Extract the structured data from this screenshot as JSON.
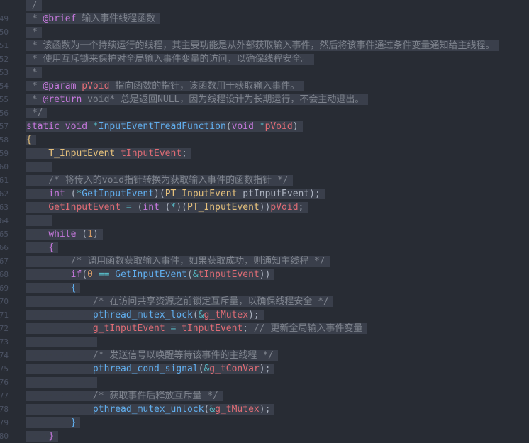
{
  "line_numbers": [
    "",
    "49",
    "50",
    "51",
    "52",
    "53",
    "54",
    "55",
    "56",
    "57",
    "58",
    "59",
    "60",
    "61",
    "62",
    "63",
    "64",
    "65",
    "66",
    "67",
    "68",
    "69",
    "70",
    "71",
    "72",
    "73",
    "74",
    "75",
    "76",
    "77",
    "78",
    "79",
    "80",
    ""
  ],
  "lines": [
    [
      {
        "c": "cm",
        "t": " /"
      }
    ],
    [
      {
        "c": "cm",
        "t": " * "
      },
      {
        "c": "tag",
        "t": "@brief"
      },
      {
        "c": "cm",
        "t": " 输入事件线程函数"
      }
    ],
    [
      {
        "c": "cm",
        "t": " *"
      }
    ],
    [
      {
        "c": "cm",
        "t": " * 该函数为一个持续运行的线程，其主要功能是从外部获取输入事件，然后将该事件通过条件变量通知给主线程。"
      }
    ],
    [
      {
        "c": "cm",
        "t": " * 使用互斥锁来保护对全局输入事件变量的访问，以确保线程安全。"
      }
    ],
    [
      {
        "c": "cm",
        "t": " *"
      }
    ],
    [
      {
        "c": "cm",
        "t": " * "
      },
      {
        "c": "tag",
        "t": "@param"
      },
      {
        "c": "cm",
        "t": " "
      },
      {
        "c": "var",
        "t": "pVoid"
      },
      {
        "c": "cm",
        "t": " 指向函数的指针，该函数用于获取输入事件。"
      }
    ],
    [
      {
        "c": "cm",
        "t": " * "
      },
      {
        "c": "tag",
        "t": "@return"
      },
      {
        "c": "cm",
        "t": " void* 总是返回NULL，因为线程设计为长期运行，不会主动退出。"
      }
    ],
    [
      {
        "c": "cm",
        "t": " */"
      }
    ],
    [
      {
        "c": "kw",
        "t": "static"
      },
      {
        "c": "pl",
        "t": " "
      },
      {
        "c": "kw",
        "t": "void"
      },
      {
        "c": "pl",
        "t": " "
      },
      {
        "c": "op",
        "t": "*"
      },
      {
        "c": "fn",
        "t": "InputEventTreadFunction"
      },
      {
        "c": "pl",
        "t": "("
      },
      {
        "c": "kw",
        "t": "void"
      },
      {
        "c": "pl",
        "t": " "
      },
      {
        "c": "op",
        "t": "*"
      },
      {
        "c": "var",
        "t": "pVoid"
      },
      {
        "c": "pl",
        "t": ")"
      }
    ],
    [
      {
        "c": "ty",
        "t": "{"
      }
    ],
    [
      {
        "c": "dots",
        "t": "····"
      },
      {
        "c": "ty",
        "t": "T_InputEvent"
      },
      {
        "c": "pl",
        "t": " "
      },
      {
        "c": "var",
        "t": "tInputEvent"
      },
      {
        "c": "pl",
        "t": ";"
      }
    ],
    [
      {
        "c": "dots",
        "t": "····"
      }
    ],
    [
      {
        "c": "dots",
        "t": "····"
      },
      {
        "c": "cm",
        "t": "/* 将传入的void指针转换为获取输入事件的函数指针 */"
      }
    ],
    [
      {
        "c": "dots",
        "t": "····"
      },
      {
        "c": "kw",
        "t": "int"
      },
      {
        "c": "pl",
        "t": " ("
      },
      {
        "c": "op",
        "t": "*"
      },
      {
        "c": "fn",
        "t": "GetInputEvent"
      },
      {
        "c": "pl",
        "t": ")("
      },
      {
        "c": "ty",
        "t": "PT_InputEvent"
      },
      {
        "c": "pl",
        "t": " ptInputEvent);"
      }
    ],
    [
      {
        "c": "dots",
        "t": "····"
      },
      {
        "c": "var",
        "t": "GetInputEvent"
      },
      {
        "c": "pl",
        "t": " "
      },
      {
        "c": "op",
        "t": "="
      },
      {
        "c": "pl",
        "t": " ("
      },
      {
        "c": "kw",
        "t": "int"
      },
      {
        "c": "pl",
        "t": " ("
      },
      {
        "c": "op",
        "t": "*"
      },
      {
        "c": "pl",
        "t": ")("
      },
      {
        "c": "ty",
        "t": "PT_InputEvent"
      },
      {
        "c": "pl",
        "t": "))"
      },
      {
        "c": "var",
        "t": "pVoid"
      },
      {
        "c": "pl",
        "t": ";"
      }
    ],
    [
      {
        "c": "dots",
        "t": "····"
      }
    ],
    [
      {
        "c": "dots",
        "t": "····"
      },
      {
        "c": "kw",
        "t": "while"
      },
      {
        "c": "pl",
        "t": " ("
      },
      {
        "c": "num",
        "t": "1"
      },
      {
        "c": "pl",
        "t": ")"
      }
    ],
    [
      {
        "c": "dots",
        "t": "····"
      },
      {
        "c": "kw",
        "t": "{"
      }
    ],
    [
      {
        "c": "dots",
        "t": "········"
      },
      {
        "c": "cm",
        "t": "/* 调用函数获取输入事件，如果获取成功，则通知主线程 */"
      }
    ],
    [
      {
        "c": "dots",
        "t": "········"
      },
      {
        "c": "kw",
        "t": "if"
      },
      {
        "c": "pl",
        "t": "("
      },
      {
        "c": "num",
        "t": "0"
      },
      {
        "c": "pl",
        "t": " "
      },
      {
        "c": "op",
        "t": "=="
      },
      {
        "c": "pl",
        "t": " "
      },
      {
        "c": "fn",
        "t": "GetInputEvent"
      },
      {
        "c": "pl",
        "t": "("
      },
      {
        "c": "op",
        "t": "&"
      },
      {
        "c": "var",
        "t": "tInputEvent"
      },
      {
        "c": "pl",
        "t": "))"
      }
    ],
    [
      {
        "c": "dots",
        "t": "········"
      },
      {
        "c": "fn",
        "t": "{"
      }
    ],
    [
      {
        "c": "dots",
        "t": "············"
      },
      {
        "c": "cm",
        "t": "/* 在访问共享资源之前锁定互斥量，以确保线程安全 */"
      }
    ],
    [
      {
        "c": "dots",
        "t": "············"
      },
      {
        "c": "fn",
        "t": "pthread_mutex_lock"
      },
      {
        "c": "pl",
        "t": "("
      },
      {
        "c": "op",
        "t": "&"
      },
      {
        "c": "var",
        "t": "g_tMutex"
      },
      {
        "c": "pl",
        "t": ");"
      }
    ],
    [
      {
        "c": "dots",
        "t": "············"
      },
      {
        "c": "var",
        "t": "g_tInputEvent"
      },
      {
        "c": "pl",
        "t": " "
      },
      {
        "c": "op",
        "t": "="
      },
      {
        "c": "pl",
        "t": " "
      },
      {
        "c": "var",
        "t": "tInputEvent"
      },
      {
        "c": "pl",
        "t": "; "
      },
      {
        "c": "cm",
        "t": "// 更新全局输入事件变量"
      }
    ],
    [
      {
        "c": "dots",
        "t": "············"
      }
    ],
    [
      {
        "c": "dots",
        "t": "············"
      },
      {
        "c": "cm",
        "t": "/* 发送信号以唤醒等待该事件的主线程 */"
      }
    ],
    [
      {
        "c": "dots",
        "t": "············"
      },
      {
        "c": "fn",
        "t": "pthread_cond_signal"
      },
      {
        "c": "pl",
        "t": "("
      },
      {
        "c": "op",
        "t": "&"
      },
      {
        "c": "var",
        "t": "g_tConVar"
      },
      {
        "c": "pl",
        "t": ");"
      }
    ],
    [
      {
        "c": "dots",
        "t": "············"
      }
    ],
    [
      {
        "c": "dots",
        "t": "············"
      },
      {
        "c": "cm",
        "t": "/* 获取事件后释放互斥量 */"
      }
    ],
    [
      {
        "c": "dots",
        "t": "············"
      },
      {
        "c": "fn",
        "t": "pthread_mutex_unlock"
      },
      {
        "c": "pl",
        "t": "("
      },
      {
        "c": "op",
        "t": "&"
      },
      {
        "c": "var",
        "t": "g_tMutex"
      },
      {
        "c": "pl",
        "t": ");"
      }
    ],
    [
      {
        "c": "dots",
        "t": "········"
      },
      {
        "c": "fn",
        "t": "}"
      }
    ],
    [
      {
        "c": "dots",
        "t": "····"
      },
      {
        "c": "kw",
        "t": "}"
      }
    ],
    [
      {
        "c": "dots",
        "t": "····"
      }
    ]
  ]
}
